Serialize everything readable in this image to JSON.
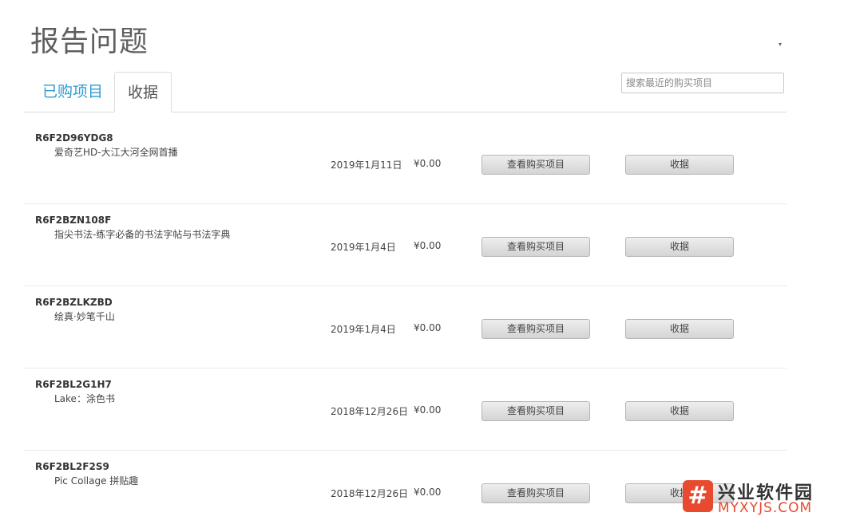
{
  "header": {
    "title": "报告问题"
  },
  "tabs": [
    {
      "label": "已购项目",
      "active": false
    },
    {
      "label": "收据",
      "active": true
    }
  ],
  "search": {
    "placeholder": "搜索最近的购买项目",
    "value": ""
  },
  "receipts": [
    {
      "id": "R6F2D96YDG8",
      "item": "爱奇艺HD-大江大河全网首播",
      "date": "2019年1月11日",
      "price": "¥0.00",
      "view_label": "查看购买项目",
      "receipt_label": "收据"
    },
    {
      "id": "R6F2BZN108F",
      "item": "指尖书法-练字必备的书法字帖与书法字典",
      "date": "2019年1月4日",
      "price": "¥0.00",
      "view_label": "查看购买项目",
      "receipt_label": "收据"
    },
    {
      "id": "R6F2BZLKZBD",
      "item": "绘真·妙笔千山",
      "date": "2019年1月4日",
      "price": "¥0.00",
      "view_label": "查看购买项目",
      "receipt_label": "收据"
    },
    {
      "id": "R6F2BL2G1H7",
      "item": "Lake：涂色书",
      "date": "2018年12月26日",
      "price": "¥0.00",
      "view_label": "查看购买项目",
      "receipt_label": "收据"
    },
    {
      "id": "R6F2BL2F2S9",
      "item": "Pic Collage 拼贴趣",
      "date": "2018年12月26日",
      "price": "¥0.00",
      "view_label": "查看购买项目",
      "receipt_label": "收据"
    }
  ],
  "watermark": {
    "title": "兴业软件园",
    "url": "MYXYJS.COM",
    "logo_glyph": "#"
  },
  "colors": {
    "accent": "#2f9ad3",
    "watermark": "#e84a2f"
  }
}
